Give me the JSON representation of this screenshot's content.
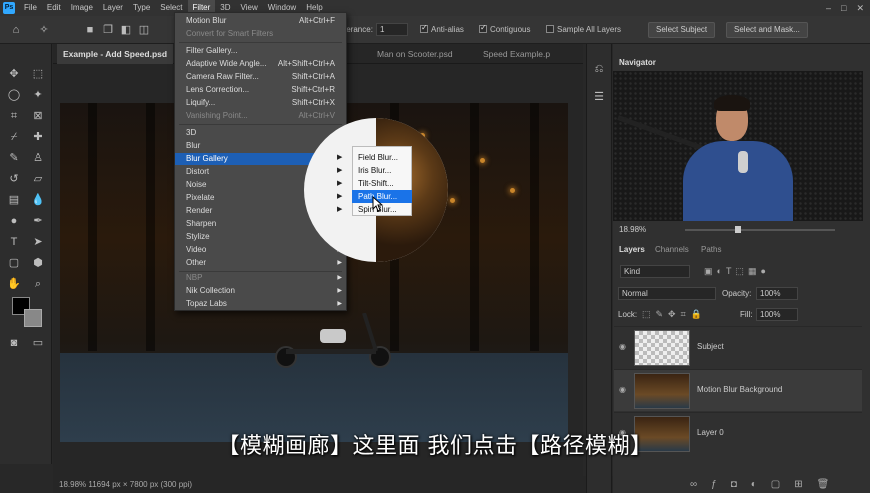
{
  "menubar": {
    "items": [
      "File",
      "Edit",
      "Image",
      "Layer",
      "Type",
      "Select",
      "Filter",
      "3D",
      "View",
      "Window",
      "Help"
    ],
    "open_item": "Filter"
  },
  "options": {
    "tolerance_label": "Tolerance:",
    "tolerance_value": "1",
    "anti_alias": "Anti-alias",
    "contiguous": "Contiguous",
    "sample_all_layers": "Sample All Layers",
    "select_subject": "Select Subject",
    "select_and_mask": "Select and Mask..."
  },
  "tabs": [
    {
      "label": "Example - Add Speed.psd"
    },
    {
      "label": "Man on Scooter.psd"
    },
    {
      "label": "Speed Example.p"
    }
  ],
  "filter_menu": {
    "items": [
      {
        "label": "Motion Blur",
        "shortcut": "Alt+Ctrl+F"
      },
      {
        "label": "Convert for Smart Filters",
        "disabled": true
      },
      {
        "sep": true
      },
      {
        "label": "Filter Gallery..."
      },
      {
        "label": "Adaptive Wide Angle...",
        "shortcut": "Alt+Shift+Ctrl+A"
      },
      {
        "label": "Camera Raw Filter...",
        "shortcut": "Shift+Ctrl+A"
      },
      {
        "label": "Lens Correction...",
        "shortcut": "Shift+Ctrl+R"
      },
      {
        "label": "Liquify...",
        "shortcut": "Shift+Ctrl+X"
      },
      {
        "label": "Vanishing Point...",
        "shortcut": "Alt+Ctrl+V",
        "disabled": true
      },
      {
        "sep": true
      },
      {
        "label": "3D",
        "sub": true
      },
      {
        "label": "Blur",
        "sub": true
      },
      {
        "label": "Blur Gallery",
        "sub": true,
        "highlight": true
      },
      {
        "label": "Distort",
        "sub": true
      },
      {
        "label": "Noise",
        "sub": true
      },
      {
        "label": "Pixelate",
        "sub": true
      },
      {
        "label": "Render",
        "sub": true
      },
      {
        "label": "Sharpen",
        "sub": true
      },
      {
        "label": "Stylize",
        "sub": true
      },
      {
        "label": "Video",
        "sub": true
      },
      {
        "label": "Other",
        "sub": true
      },
      {
        "sep": true
      },
      {
        "label": "NBP",
        "sub": true,
        "disabled": true
      },
      {
        "label": "Nik Collection",
        "sub": true
      },
      {
        "label": "Topaz Labs",
        "sub": true
      }
    ]
  },
  "blur_gallery_submenu": {
    "items": [
      {
        "label": "Field Blur..."
      },
      {
        "label": "Iris Blur..."
      },
      {
        "label": "Tilt-Shift..."
      },
      {
        "label": "Path Blur...",
        "highlight": true
      },
      {
        "label": "Spin Blur..."
      }
    ]
  },
  "navigator": {
    "title": "Navigator",
    "zoom": "18.98%"
  },
  "layers_panel": {
    "tabs": [
      "Layers",
      "Channels",
      "Paths"
    ],
    "kind": "Kind",
    "blend_mode": "Normal",
    "opacity_label": "Opacity:",
    "opacity_value": "100%",
    "lock_label": "Lock:",
    "fill_label": "Fill:",
    "fill_value": "100%",
    "layers": [
      {
        "name": "Subject"
      },
      {
        "name": "Motion Blur Background",
        "selected": true
      },
      {
        "name": "Layer 0"
      }
    ]
  },
  "status": {
    "text": "18.98%  11694 px × 7800 px (300 ppi)"
  },
  "subtitle": "【模糊画廊】这里面 我们点击【路径模糊】",
  "colors": {
    "accent": "#1d5fb5",
    "ps_blue": "#31a8ff"
  }
}
